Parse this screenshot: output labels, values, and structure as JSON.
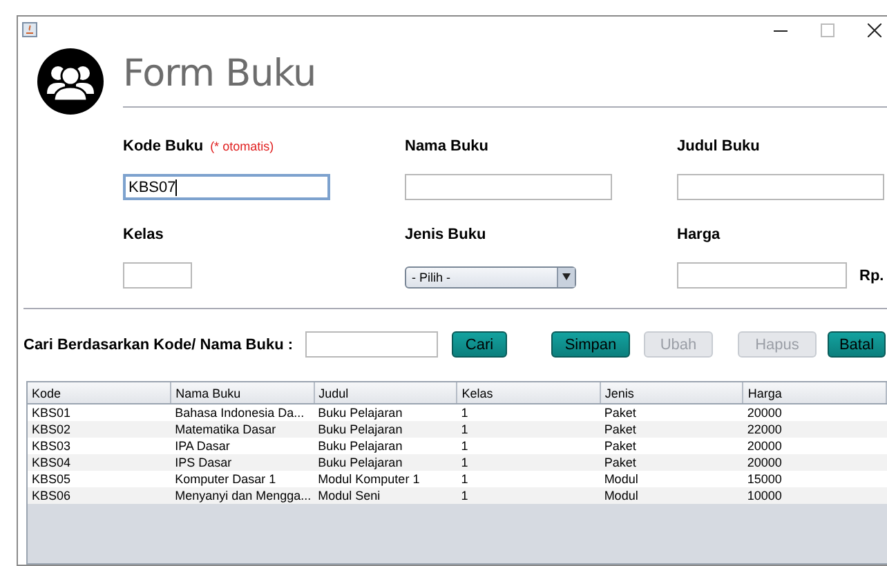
{
  "header": {
    "title": "Form Buku"
  },
  "fields": [
    {
      "label": "Kode Buku",
      "note": "(* otomatis)",
      "kind": "text",
      "value": "KBS07",
      "focused": true
    },
    {
      "label": "Nama Buku",
      "kind": "text",
      "focused": false
    },
    {
      "label": "Judul Buku",
      "kind": "text",
      "focused": false
    },
    {
      "label": "Kelas",
      "kind": "short",
      "focused": false
    },
    {
      "label": "Jenis Buku",
      "kind": "select",
      "value": "- Pilih -"
    },
    {
      "label": "Harga",
      "kind": "text",
      "suffix": "Rp.",
      "focused": false
    }
  ],
  "search": {
    "label": "Cari Berdasarkan Kode/ Nama Buku :"
  },
  "buttons": [
    {
      "label": "Cari",
      "disabled": false
    },
    {
      "label": "Simpan",
      "disabled": false
    },
    {
      "label": "Ubah",
      "disabled": true
    },
    {
      "label": "Hapus",
      "disabled": true
    },
    {
      "label": "Batal",
      "disabled": false
    }
  ],
  "table": {
    "columns": [
      "Kode",
      "Nama Buku",
      "Judul",
      "Kelas",
      "Jenis",
      "Harga"
    ],
    "rows": [
      [
        "KBS01",
        "Bahasa Indonesia Da...",
        "Buku Pelajaran",
        "1",
        "Paket",
        "20000"
      ],
      [
        "KBS02",
        "Matematika Dasar",
        "Buku Pelajaran",
        "1",
        "Paket",
        "22000"
      ],
      [
        "KBS03",
        "IPA Dasar",
        "Buku Pelajaran",
        "1",
        "Paket",
        "20000"
      ],
      [
        "KBS04",
        "IPS Dasar",
        "Buku Pelajaran",
        "1",
        "Paket",
        "20000"
      ],
      [
        "KBS05",
        "Komputer Dasar 1",
        "Modul Komputer 1",
        "1",
        "Modul",
        "15000"
      ],
      [
        "KBS06",
        "Menyanyi dan Mengga...",
        "Modul Seni",
        "1",
        "Modul",
        "10000"
      ]
    ]
  }
}
